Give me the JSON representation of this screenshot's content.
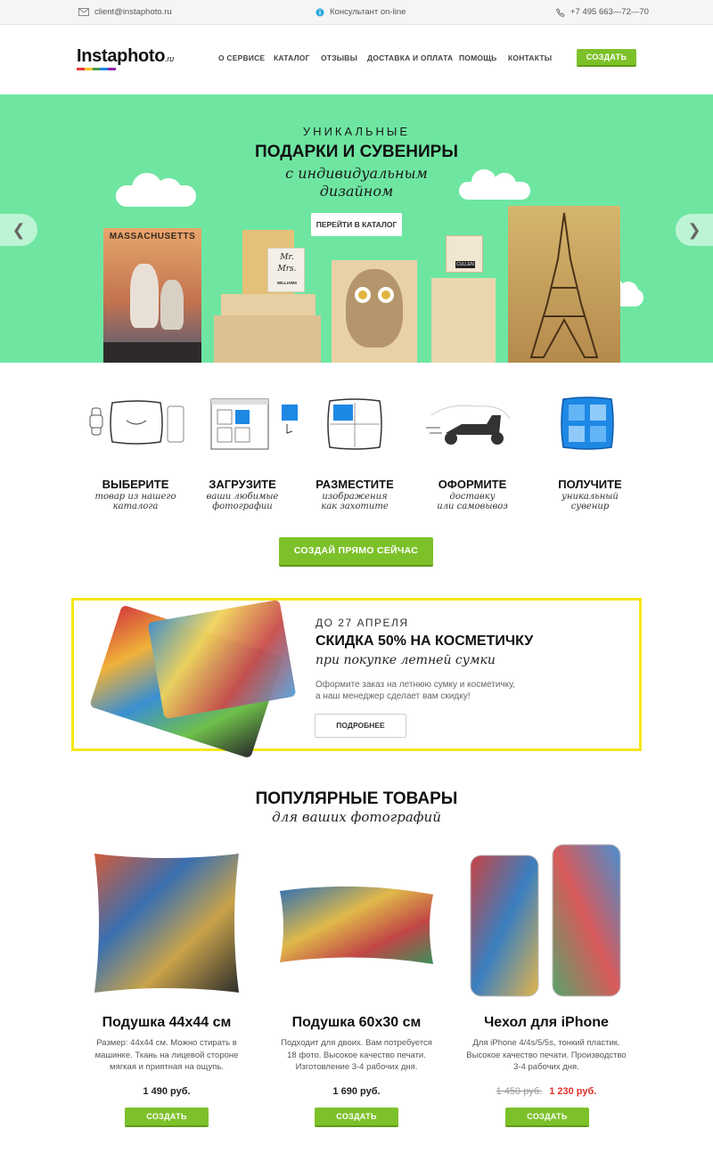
{
  "topbar": {
    "email": "client@instaphoto.ru",
    "consultant": "Консультант on-line",
    "phone": "+7 495 663—72—70"
  },
  "header": {
    "logo_main": "Instaphoto",
    "logo_tld": ".ru",
    "nav": [
      "О СЕРВИСЕ",
      "КАТАЛОГ",
      "ОТЗЫВЫ",
      "ДОСТАВКА И ОПЛАТА",
      "ПОМОЩЬ",
      "КОНТАКТЫ"
    ],
    "create_label": "СОЗДАТЬ"
  },
  "hero": {
    "line1": "УНИКАЛЬНЫЕ",
    "line2": "ПОДАРКИ И СУВЕНИРЫ",
    "line3": "с индивидуальным",
    "line4": "дизайном",
    "button": "ПЕРЕЙТИ В КАТАЛОГ",
    "poster_text": "MASSACHUSETTS",
    "card_line1": "Mr.",
    "card_line2": "Mrs.",
    "card_line3": "WILLIAMS",
    "photo_label": "CULLEN"
  },
  "steps": [
    {
      "title": "ВЫБЕРИТЕ",
      "sub1": "товар из нашего",
      "sub2": "каталога"
    },
    {
      "title": "ЗАГРУЗИТЕ",
      "sub1": "ваши любимые",
      "sub2": "фотографии"
    },
    {
      "title": "РАЗМЕСТИТЕ",
      "sub1": "изображения",
      "sub2": "как захотите"
    },
    {
      "title": "ОФОРМИТЕ",
      "sub1": "доставку",
      "sub2": "или самовывоз"
    },
    {
      "title": "ПОЛУЧИТЕ",
      "sub1": "уникальный",
      "sub2": "сувенир"
    }
  ],
  "cta": "СОЗДАЙ ПРЯМО СЕЙЧАС",
  "promo": {
    "date": "ДО 27 АПРЕЛЯ",
    "title": "СКИДКА 50% НА КОСМЕТИЧКУ",
    "subtitle": "при покупке летней сумки",
    "text1": "Оформите заказ на летнюю сумку и косметичку,",
    "text2": "а наш менеджер сделает вам скидку!",
    "button": "ПОДРОБНЕЕ"
  },
  "popular": {
    "title": "ПОПУЛЯРНЫЕ ТОВАРЫ",
    "subtitle": "для ваших фотографий"
  },
  "products": [
    {
      "name": "Подушка 44х44 см",
      "desc1": "Размер: 44х44 см. Можно стирать в",
      "desc2": "машинке. Ткань на лицевой стороне",
      "desc3": "мягкая и приятная на ощупь.",
      "price": "1 490 руб.",
      "button": "СОЗДАТЬ"
    },
    {
      "name": "Подушка 60х30 см",
      "desc1": "Подходит для двоих. Вам потребуется",
      "desc2": "18 фото. Высокое качество печати.",
      "desc3": "Изготовление 3-4 рабочих дня.",
      "price": "1 690 руб.",
      "button": "СОЗДАТЬ"
    },
    {
      "name": "Чехол для iPhone",
      "desc1": "Для iPhone 4/4s/5/5s, тонкий пластик.",
      "desc2": "Высокое качество печати. Производство",
      "desc3": "3-4 рабочих дня.",
      "old_price": "1 450 руб.",
      "price": "1 230 руб.",
      "button": "СОЗДАТЬ"
    }
  ],
  "colors": {
    "accent_green": "#7dc12a",
    "hero_bg": "#6ee6a2",
    "promo_border": "#f6e617",
    "sale_red": "#e0312b",
    "icon_blue": "#1e88e5"
  }
}
